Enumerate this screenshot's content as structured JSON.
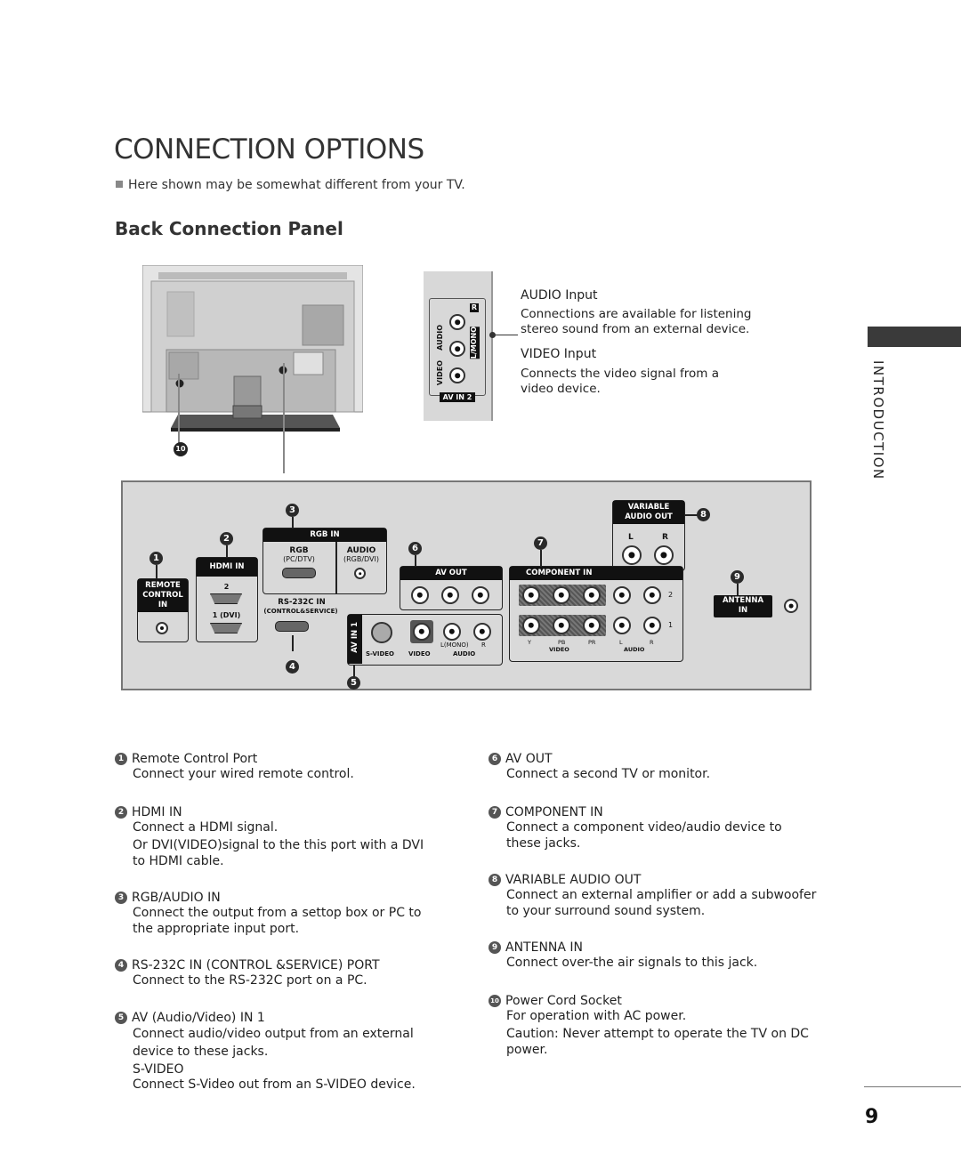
{
  "page": {
    "title": "CONNECTION OPTIONS",
    "note": "Here shown may be somewhat different from your TV.",
    "subtitle": "Back Connection Panel",
    "side_label": "INTRODUCTION",
    "page_number": "9"
  },
  "av_in2": {
    "labels": {
      "audio": "AUDIO",
      "video": "VIDEO",
      "r": "R",
      "lmono": "L/MONO",
      "badge": "AV IN 2"
    },
    "audio_heading": "AUDIO Input",
    "audio_text": "Connections are available for listening stereo sound from an external device.",
    "video_heading": "VIDEO Input",
    "video_text": "Connects the video signal from a video device."
  },
  "tv": {
    "callout": "10"
  },
  "panel": {
    "remote": {
      "num": "1",
      "label": "REMOTE CONTROL IN"
    },
    "hdmi": {
      "num": "2",
      "label": "HDMI IN",
      "port2": "2",
      "port1": "1 (DVI)"
    },
    "rgb": {
      "num": "3",
      "label": "RGB IN",
      "rgb": "RGB",
      "rgb_sub": "(PC/DTV)",
      "audio": "AUDIO",
      "audio_sub": "(RGB/DVI)"
    },
    "rs232": {
      "num": "4",
      "label": "RS-232C IN",
      "sub": "(CONTROL&SERVICE)"
    },
    "avin1": {
      "num": "5",
      "label": "AV IN 1",
      "svideo": "S-VIDEO",
      "video": "VIDEO",
      "lmono": "L(MONO)",
      "r": "R",
      "audio": "AUDIO"
    },
    "avout": {
      "num": "6",
      "label": "AV OUT"
    },
    "component": {
      "num": "7",
      "label": "COMPONENT IN",
      "row2": "2",
      "row1": "1",
      "y": "Y",
      "pb": "PB",
      "pr": "PR",
      "video": "VIDEO",
      "l": "L",
      "r": "R",
      "audio": "AUDIO"
    },
    "var_audio": {
      "num": "8",
      "label1": "VARIABLE",
      "label2": "AUDIO OUT",
      "l": "L",
      "r": "R"
    },
    "antenna": {
      "num": "9",
      "label1": "ANTENNA",
      "label2": "IN"
    }
  },
  "descriptions": {
    "left": [
      {
        "num": "1",
        "heading": "Remote Control Port",
        "lines": [
          "Connect your wired remote control."
        ]
      },
      {
        "num": "2",
        "heading": "HDMI IN",
        "lines": [
          "Connect a HDMI signal.",
          "Or DVI(VIDEO)signal to the this port with a DVI to HDMI cable."
        ]
      },
      {
        "num": "3",
        "heading": "RGB/AUDIO IN",
        "lines": [
          "Connect the output from a settop box or PC to the appropriate input port."
        ]
      },
      {
        "num": "4",
        "heading": "RS-232C IN (CONTROL &SERVICE) PORT",
        "lines": [
          "Connect to the RS-232C port on a PC."
        ]
      },
      {
        "num": "5",
        "heading": "AV (Audio/Video) IN 1",
        "lines": [
          "Connect audio/video output from an external device to these jacks."
        ],
        "subheading": "S-VIDEO",
        "sublines": [
          "Connect S-Video out from an S-VIDEO device."
        ]
      }
    ],
    "right": [
      {
        "num": "6",
        "heading": "AV OUT",
        "lines": [
          "Connect a second TV or monitor."
        ]
      },
      {
        "num": "7",
        "heading": "COMPONENT IN",
        "lines": [
          "Connect a component video/audio device to these jacks."
        ]
      },
      {
        "num": "8",
        "heading": "VARIABLE AUDIO OUT",
        "lines": [
          "Connect an external amplifier or add a subwoofer to your surround sound system."
        ]
      },
      {
        "num": "9",
        "heading": "ANTENNA IN",
        "lines": [
          "Connect over-the air signals to this jack."
        ]
      },
      {
        "num": "10",
        "heading": "Power Cord Socket",
        "lines": [
          "For operation with AC power.",
          "Caution: Never attempt to operate the TV on DC power."
        ]
      }
    ]
  }
}
